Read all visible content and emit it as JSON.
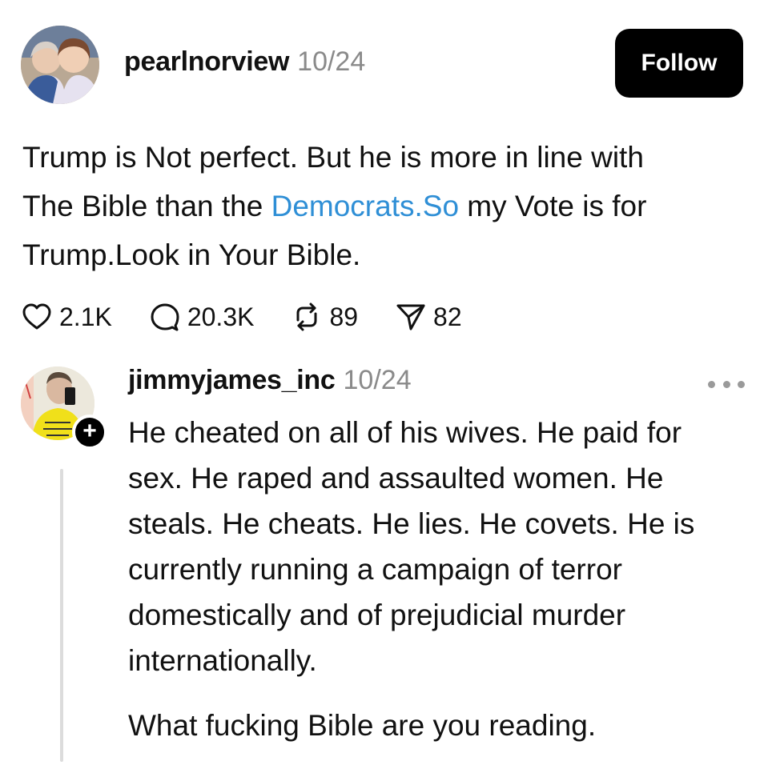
{
  "post": {
    "avatar_icon": "profile-photo-two-people",
    "username": "pearlnorview",
    "date": "10/24",
    "follow_label": "Follow",
    "text_line1": "Trump is Not perfect. But he is more in line with",
    "text_line2_before": "The Bible than the ",
    "text_line2_link": "Democrats.So",
    "text_line2_after": " my Vote is for",
    "text_line3": "Trump.Look in Your Bible.",
    "likes": "2.1K",
    "comments": "20.3K",
    "reposts": "89",
    "shares": "82",
    "link_color": "#2f8fd6"
  },
  "reply": {
    "avatar_icon": "profile-photo-selfie",
    "badge": "+",
    "username": "jimmyjames_inc",
    "date": "10/24",
    "lines": [
      "He cheated on all of his wives. He paid for",
      "sex. He raped and assaulted women. He",
      "steals. He cheats. He lies. He covets. He is",
      "currently running a campaign of terror",
      "domestically and of prejudicial murder",
      "internationally."
    ],
    "last_line": "What fucking Bible are you reading."
  }
}
